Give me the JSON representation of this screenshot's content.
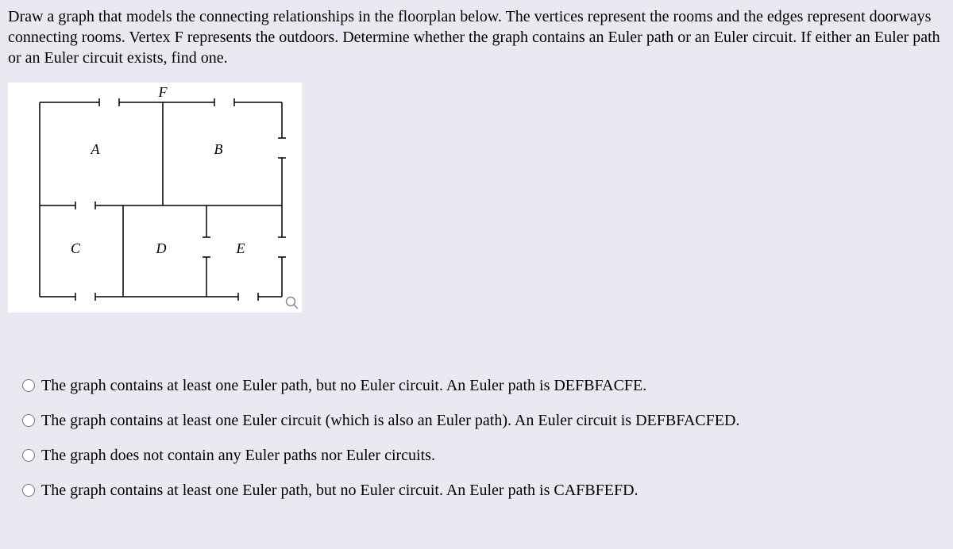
{
  "question": "Draw a graph that models the connecting relationships in the floorplan below. The vertices represent the rooms and the edges represent doorways connecting rooms. Vertex F represents the outdoors. Determine whether the graph contains an Euler path or an Euler circuit. If either an Euler path or an Euler circuit exists, find one.",
  "floorplan": {
    "labels": {
      "F": "F",
      "A": "A",
      "B": "B",
      "C": "C",
      "D": "D",
      "E": "E"
    }
  },
  "options": [
    "The graph contains at least one Euler path, but no Euler circuit. An Euler path is DEFBFACFE.",
    "The graph contains at least one Euler circuit (which is also an Euler path). An Euler circuit is DEFBFACFED.",
    "The graph does not contain any Euler paths nor Euler circuits.",
    "The graph contains at least one Euler path, but no Euler circuit. An Euler path is CAFBFEFD."
  ]
}
